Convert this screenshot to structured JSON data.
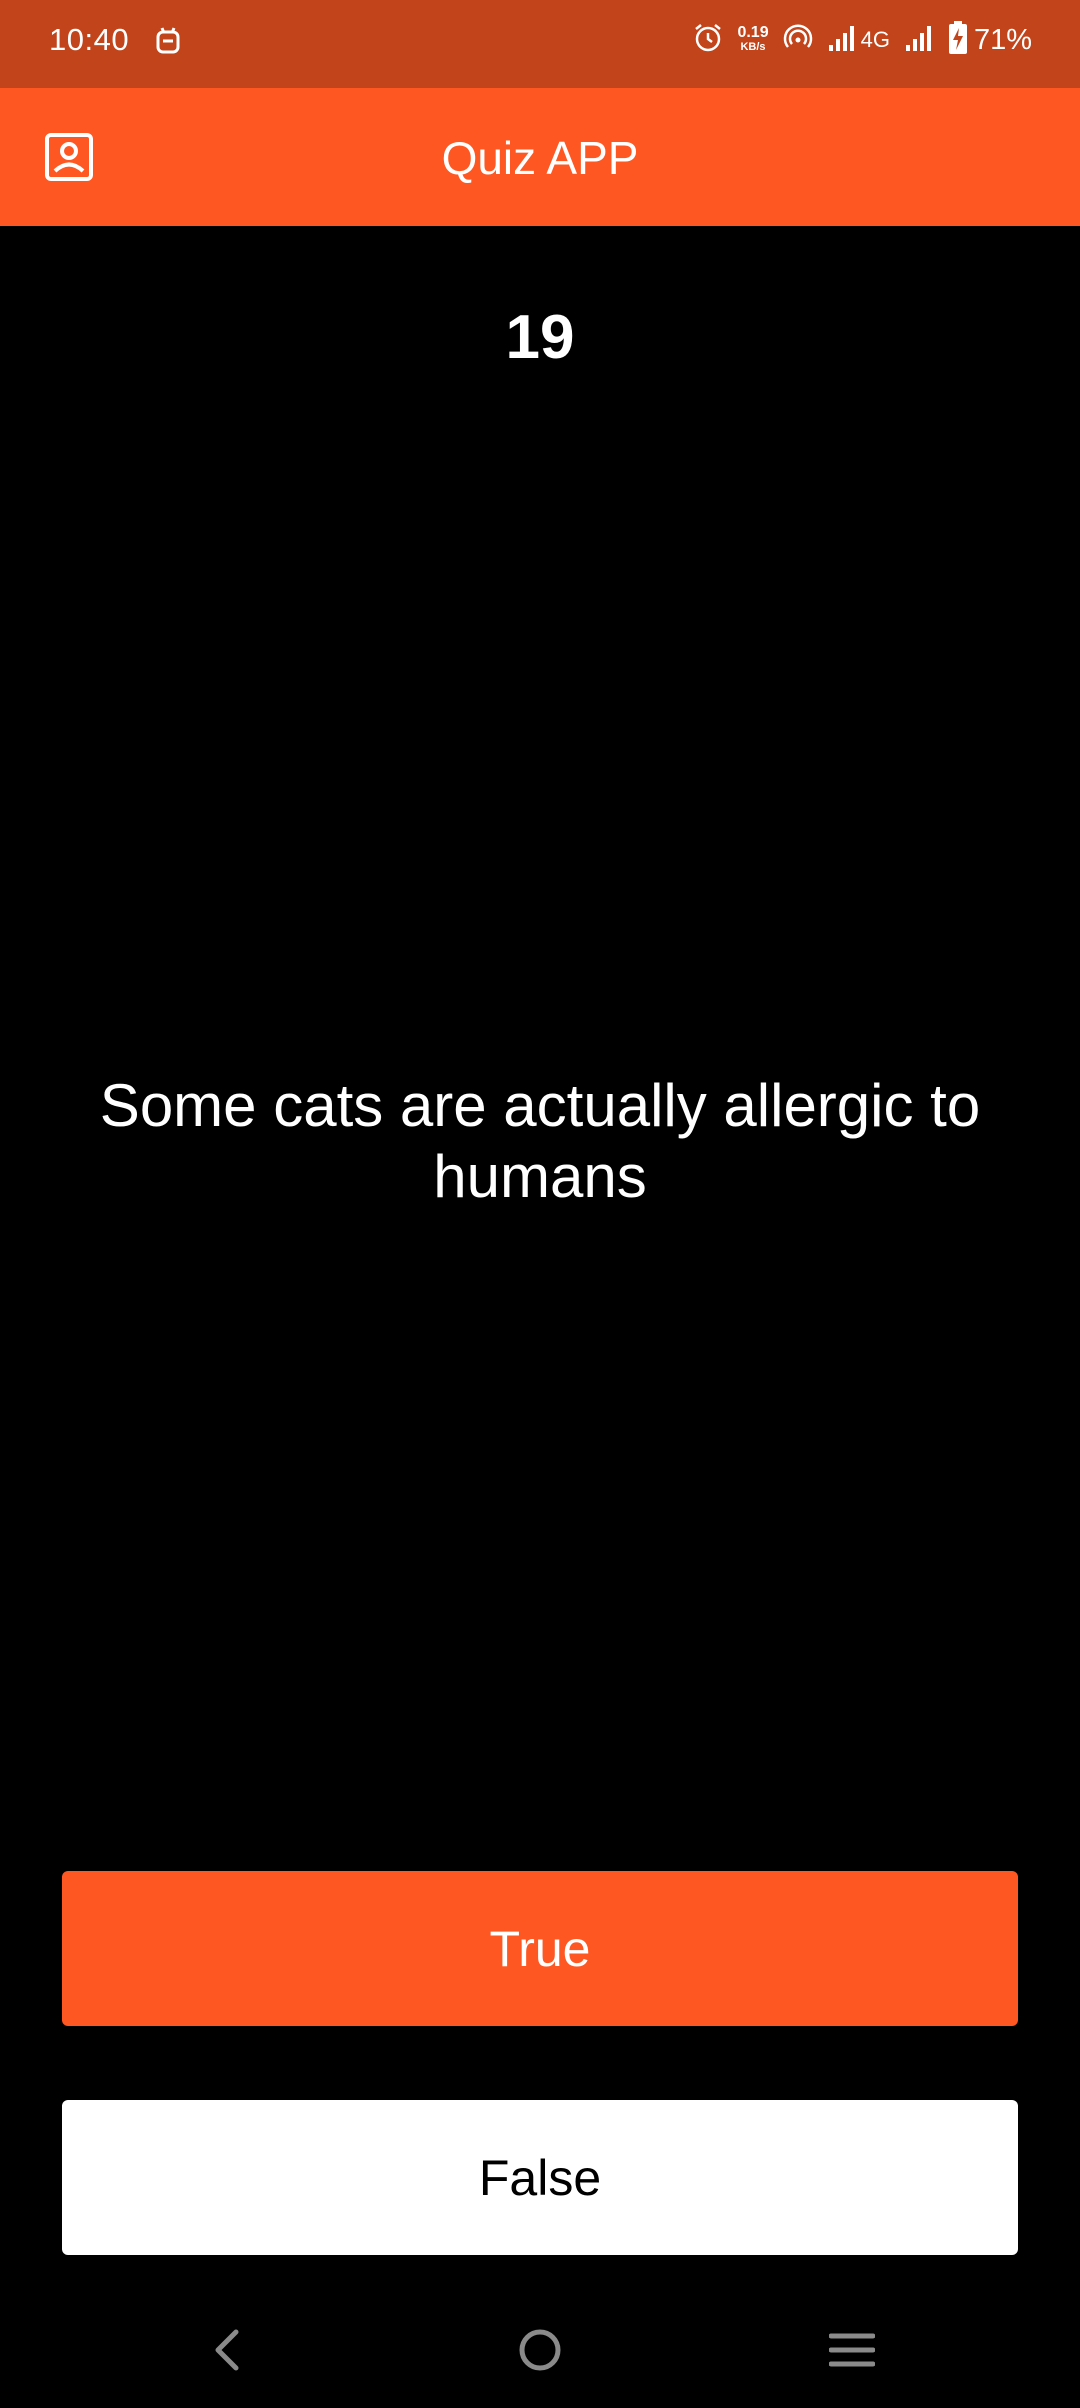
{
  "status_bar": {
    "time": "10:40",
    "speed_value": "0.19",
    "speed_unit": "KB/s",
    "network": "4G",
    "battery": "71%"
  },
  "app_bar": {
    "title": "Quiz APP",
    "icon": "account-box-icon"
  },
  "quiz": {
    "question_number": "19",
    "question_text": "Some cats are actually allergic to humans"
  },
  "buttons": {
    "true_label": "True",
    "false_label": "False"
  },
  "colors": {
    "status_bar": "#c1441b",
    "accent": "#ff5722",
    "background": "#000000",
    "false_button": "#ffffff"
  },
  "nav_bar": {
    "icons": [
      "back-icon",
      "home-icon",
      "recents-menu-icon"
    ]
  }
}
